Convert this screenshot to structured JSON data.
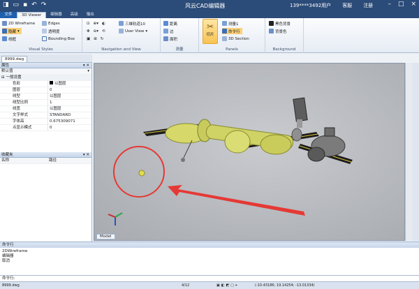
{
  "titlebar": {
    "title": "风云CAD编辑器",
    "user": "139****3492用户",
    "service": "客服",
    "login": "注册"
  },
  "tabs": [
    "文件",
    "3D Viewer",
    "编辑器",
    "高级",
    "输出"
  ],
  "ribbon": {
    "visual_styles": {
      "items": [
        "2D Wireframe",
        "隐藏",
        "线框",
        "Edges",
        "透明度",
        "Bounding Box"
      ],
      "title": "Visual Styles"
    },
    "nav": {
      "items": [
        "三维轨道10",
        "User View"
      ],
      "title": "Navigation and View"
    },
    "measure": {
      "items": [
        "距离",
        "边",
        "面积"
      ],
      "title": "测量"
    },
    "panels": {
      "big": "切片",
      "items": [
        "测量1",
        "命令行",
        "3D Section"
      ],
      "title": "Panels"
    },
    "background": {
      "items": [
        "黑色背景",
        "背景色"
      ],
      "title": "Background"
    }
  },
  "doc_tab": "8999.dwg",
  "properties": {
    "title": "属性",
    "selector": "默认值",
    "group": "一般设置",
    "rows": [
      {
        "k": "色彩",
        "v": "以图层"
      },
      {
        "k": "图层",
        "v": "0"
      },
      {
        "k": "线型",
        "v": "以图层"
      },
      {
        "k": "线型比例",
        "v": "1"
      },
      {
        "k": "线宽",
        "v": "以图层"
      },
      {
        "k": "文字样式",
        "v": "STANDARD"
      },
      {
        "k": "字体高",
        "v": "0.675309071"
      },
      {
        "k": "点显示模式",
        "v": "0"
      }
    ]
  },
  "favorites": {
    "title": "收藏夹",
    "col1": "名称",
    "col2": "路径"
  },
  "model_tab": "Model",
  "command": {
    "title": "命令行",
    "log": [
      "2DWireframe",
      "编辑器",
      "取消"
    ],
    "prompt": "命令行:"
  },
  "status": {
    "file": "8999.dwg",
    "page": "4/12",
    "coords": "(-10.43186; 19.14254; -13.01334)"
  },
  "colors": {
    "accent": "#2b4b78",
    "highlight": "#e53935"
  }
}
